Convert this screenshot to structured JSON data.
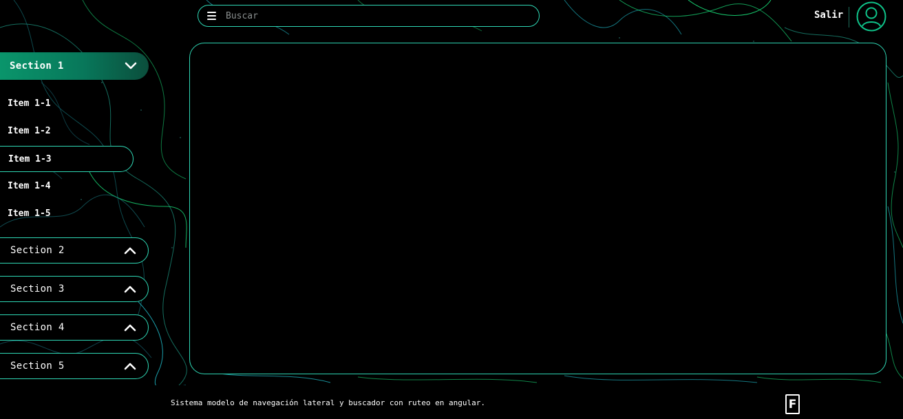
{
  "header": {
    "search_placeholder": "Buscar",
    "logout_label": "Salir",
    "menu_icon": "menu-icon",
    "avatar_icon": "user-circle-icon"
  },
  "sidebar": {
    "sections": [
      {
        "label": "Section 1",
        "expanded": true,
        "icon": "chevron-down-icon",
        "items": [
          {
            "label": "Item 1-1"
          },
          {
            "label": "Item 1-2"
          },
          {
            "label": "Item 1-3",
            "selected": true
          },
          {
            "label": "Item 1-4"
          },
          {
            "label": "Item 1-5"
          }
        ]
      },
      {
        "label": "Section 2",
        "expanded": false,
        "icon": "chevron-up-icon"
      },
      {
        "label": "Section 3",
        "expanded": false,
        "icon": "chevron-up-icon"
      },
      {
        "label": "Section 4",
        "expanded": false,
        "icon": "chevron-up-icon"
      },
      {
        "label": "Section 5",
        "expanded": false,
        "icon": "chevron-up-icon"
      }
    ]
  },
  "footer": {
    "text": "Sistema modelo de navegación lateral y buscador con ruteo en angular.",
    "logo_letter": "F"
  },
  "colors": {
    "accent": "#2fd9b6",
    "active_section": "#0a9a6e",
    "background": "#000000",
    "contour_green": "#19e07a",
    "contour_cyan": "#22c7d6"
  }
}
